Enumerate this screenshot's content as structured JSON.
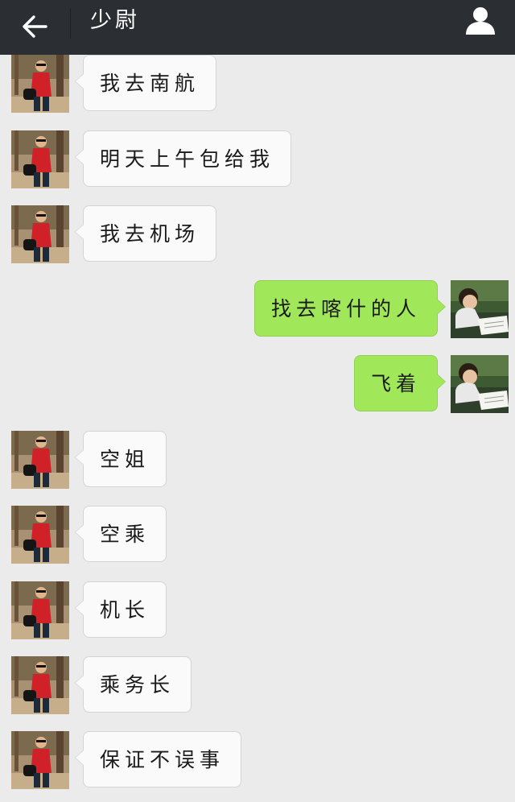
{
  "header": {
    "title": "少尉",
    "back_icon": "arrow-left-icon",
    "profile_icon": "person-icon",
    "background": "#2b2f33"
  },
  "chat": {
    "incoming_bubble_color": "#fafafa",
    "outgoing_bubble_color": "#a0e75a",
    "background": "#ebebeb",
    "messages": [
      {
        "side": "in",
        "text": "我去南航"
      },
      {
        "side": "in",
        "text": "明天上午包给我"
      },
      {
        "side": "in",
        "text": "我去机场"
      },
      {
        "side": "out",
        "text": "找去喀什的人"
      },
      {
        "side": "out",
        "text": "飞着"
      },
      {
        "side": "in",
        "text": "空姐"
      },
      {
        "side": "in",
        "text": "空乘"
      },
      {
        "side": "in",
        "text": "机长"
      },
      {
        "side": "in",
        "text": "乘务长"
      },
      {
        "side": "in",
        "text": "保证不误事"
      }
    ]
  }
}
